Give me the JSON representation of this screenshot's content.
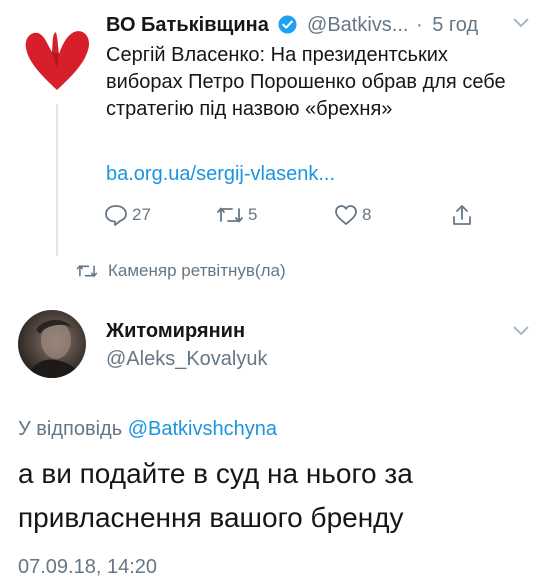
{
  "original_tweet": {
    "author_name": "ВО Батьківщина",
    "handle": "@Batkivs...",
    "separator": "·",
    "time": "5 год",
    "text": "Сергій Власенко: На президентських виборах Петро Порошенко обрав для себе стратегію під назвою «брехня»",
    "link": "ba.org.ua/sergij-vlasenk...",
    "replies_count": "27",
    "retweets_count": "5",
    "likes_count": "8"
  },
  "retweet_notice": {
    "text": "Каменяр ретвітнув(ла)"
  },
  "reply_tweet": {
    "author_name": "Житомирянин",
    "handle": "@Aleks_Kovalyuk",
    "reply_prefix": "У відповідь",
    "reply_to_handle": "@Batkivshchyna",
    "text": "а ви подайте в суд на нього за привласнення вашого бренду",
    "timestamp": "07.09.18, 14:20"
  },
  "colors": {
    "brand_heart": "#d71f2b",
    "verified": "#1da1f2",
    "link": "#1b95e0",
    "secondary_text": "#657786"
  },
  "icons": [
    "heart-logo-icon",
    "verified-badge-icon",
    "chevron-down-icon",
    "reply-icon",
    "retweet-icon",
    "like-icon",
    "share-icon"
  ]
}
